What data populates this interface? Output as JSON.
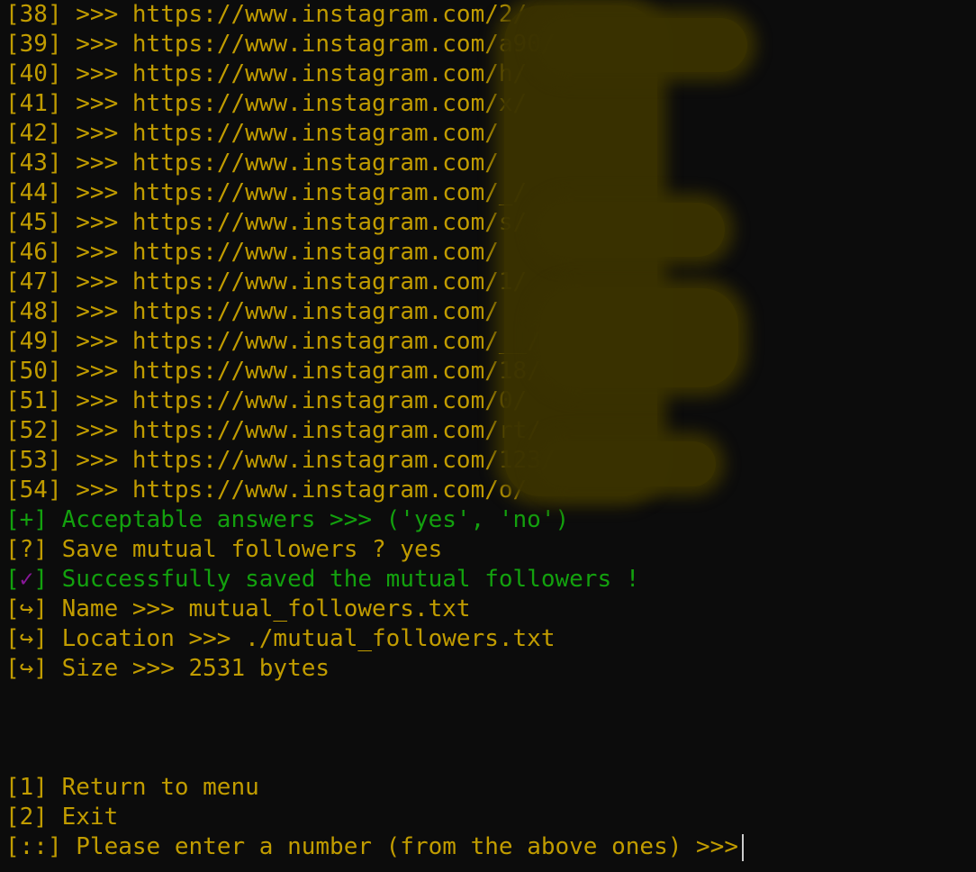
{
  "url_lines": [
    {
      "index": "[38]",
      "arrow": ">>>",
      "url": "https://www.instagram.com/2/"
    },
    {
      "index": "[39]",
      "arrow": ">>>",
      "url": "https://www.instagram.com/a90/"
    },
    {
      "index": "[40]",
      "arrow": ">>>",
      "url": "https://www.instagram.com/h/"
    },
    {
      "index": "[41]",
      "arrow": ">>>",
      "url": "https://www.instagram.com/x/"
    },
    {
      "index": "[42]",
      "arrow": ">>>",
      "url": "https://www.instagram.com/"
    },
    {
      "index": "[43]",
      "arrow": ">>>",
      "url": "https://www.instagram.com/"
    },
    {
      "index": "[44]",
      "arrow": ">>>",
      "url": "https://www.instagram.com/_/"
    },
    {
      "index": "[45]",
      "arrow": ">>>",
      "url": "https://www.instagram.com/s/"
    },
    {
      "index": "[46]",
      "arrow": ">>>",
      "url": "https://www.instagram.com/"
    },
    {
      "index": "[47]",
      "arrow": ">>>",
      "url": "https://www.instagram.com/1/"
    },
    {
      "index": "[48]",
      "arrow": ">>>",
      "url": "https://www.instagram.com/"
    },
    {
      "index": "[49]",
      "arrow": ">>>",
      "url": "https://www.instagram.com/__/"
    },
    {
      "index": "[50]",
      "arrow": ">>>",
      "url": "https://www.instagram.com/18/"
    },
    {
      "index": "[51]",
      "arrow": ">>>",
      "url": "https://www.instagram.com/0/"
    },
    {
      "index": "[52]",
      "arrow": ">>>",
      "url": "https://www.instagram.com/rt/"
    },
    {
      "index": "[53]",
      "arrow": ">>>",
      "url": "https://www.instagram.com/123/"
    },
    {
      "index": "[54]",
      "arrow": ">>>",
      "url": "https://www.instagram.com/o/"
    }
  ],
  "acceptable": {
    "prefix": "[+]",
    "text": "Acceptable answers >>> ('yes', 'no')"
  },
  "save_prompt": {
    "prefix": "[?]",
    "text": "Save mutual followers ? yes"
  },
  "success": {
    "open": "[",
    "mark": "✓",
    "close": "]",
    "text": "Successfully saved the mutual followers !"
  },
  "details": [
    {
      "prefix": "[↪]",
      "text": "Name >>> mutual_followers.txt"
    },
    {
      "prefix": "[↪]",
      "text": "Location >>> ./mutual_followers.txt"
    },
    {
      "prefix": "[↪]",
      "text": "Size >>> 2531 bytes"
    }
  ],
  "menu": [
    {
      "prefix": "[1]",
      "label": "Return to menu"
    },
    {
      "prefix": "[2]",
      "label": "Exit"
    }
  ],
  "input_prompt": {
    "prefix": "[::]",
    "text": "Please enter a number (from the above ones) >>>"
  },
  "colors": {
    "background": "#0c0c0c",
    "text": "#c19c00",
    "success": "#13a10e",
    "checkmark": "#881798",
    "redaction": "#3a3200"
  }
}
